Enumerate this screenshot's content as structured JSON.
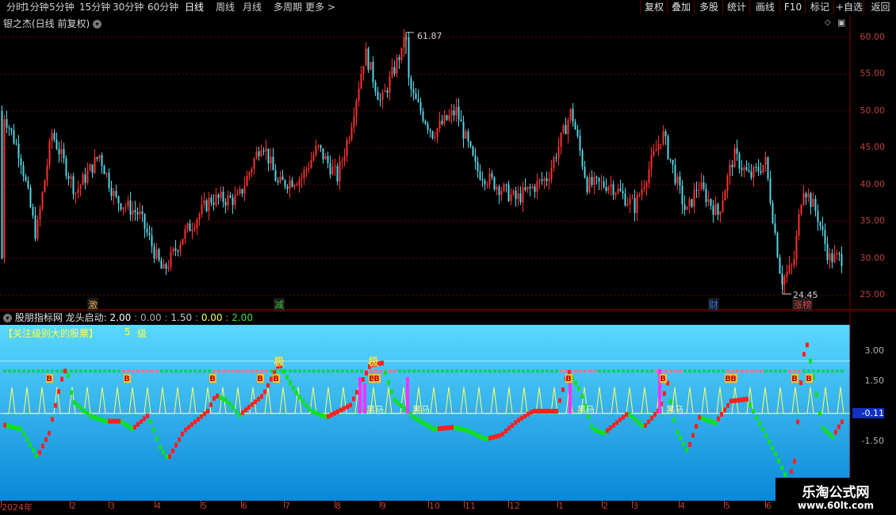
{
  "toolbar": {
    "periods": [
      "分时",
      "1分钟",
      "5分钟",
      "15分钟",
      "30分钟",
      "60分钟",
      "日线",
      "周线",
      "月线",
      "多周期",
      "更多 >"
    ],
    "active_period": "日线",
    "buttons": [
      "复权",
      "叠加",
      "多股",
      "统计",
      "画线",
      "F10",
      "标记",
      "+自选",
      "返回"
    ]
  },
  "main": {
    "title": "银之杰(日线 前复权)",
    "y_ticks": [
      "60.00",
      "55.00",
      "50.00",
      "45.00",
      "40.00",
      "35.00",
      "30.00",
      "25.00"
    ],
    "high_label": "61.87",
    "low_label": "24.45",
    "events": [
      "激",
      "减",
      "财",
      "涨榜"
    ],
    "colors": {
      "up": "#ff3030",
      "down": "#54d6e6",
      "grid": "#6a0000"
    }
  },
  "indicator": {
    "provider": "股朋指标网",
    "name": "龙头启动:",
    "values": [
      "2.00",
      "0.00",
      "1.50",
      "0.00",
      "2.00"
    ],
    "banner": "【关注级别大的股票】",
    "level_num": "5",
    "level_unit": "级",
    "y_ticks": [
      "3.00",
      "1.50",
      "-0.11",
      "-1.50"
    ],
    "labels": {
      "buy": "B",
      "big": "极",
      "heima": "黑马"
    }
  },
  "x_axis": {
    "labels": [
      "2024年",
      "2",
      "3",
      "4",
      "5",
      "6",
      "7",
      "8",
      "9",
      "10",
      "11",
      "12",
      "1",
      "2",
      "3",
      "4",
      "5",
      "6"
    ]
  },
  "watermark": {
    "title": "乐淘公式网",
    "url": "www.60lt.com"
  },
  "chart_data": {
    "type": "candlestick",
    "title": "银之杰(日线 前复权)",
    "ylim": [
      23,
      63
    ],
    "annotations": {
      "max": 61.87,
      "min": 24.45
    }
  }
}
